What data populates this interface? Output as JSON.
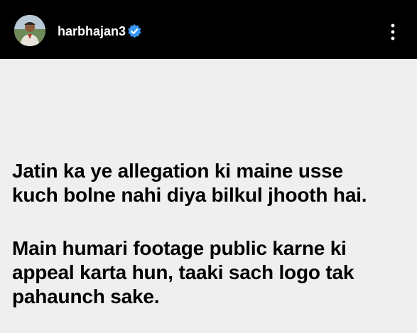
{
  "header": {
    "username": "harbhajan3",
    "verified": true,
    "verified_color": "#3897f0",
    "avatar_icon": "profile-photo",
    "menu_icon": "more-vertical-icon"
  },
  "post": {
    "paragraphs": [
      "Jatin ka ye allegation ki maine usse\nkuch bolne nahi diya bilkul jhooth hai.",
      "Main humari footage public karne ki\nappeal karta hun, taaki sach logo tak\npahaunch sake."
    ]
  },
  "colors": {
    "header_bg": "#000000",
    "post_bg": "#efefef",
    "text": "#000000"
  }
}
